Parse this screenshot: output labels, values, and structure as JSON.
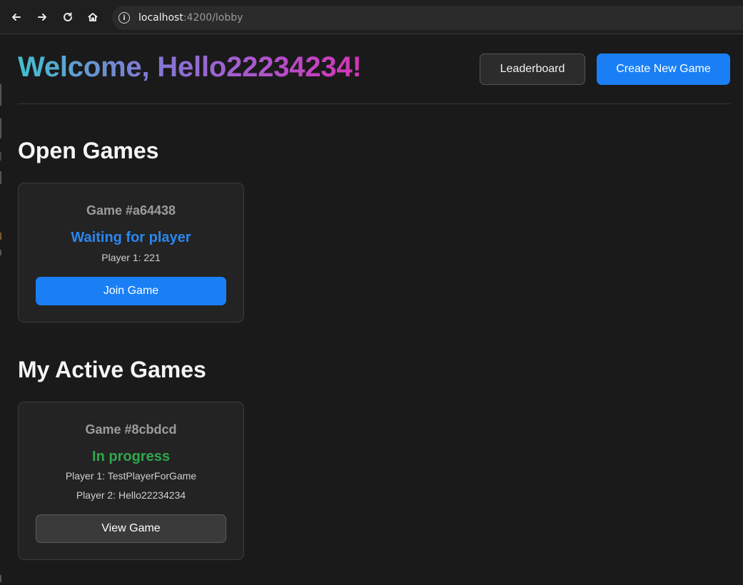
{
  "browser": {
    "url_host": "localhost",
    "url_path": ":4200/lobby"
  },
  "header": {
    "welcome": "Welcome, Hello22234234!",
    "leaderboard_label": "Leaderboard",
    "create_label": "Create New Game",
    "accent_color": "#1a7ff5",
    "gradient_colors": [
      "#44bfcf",
      "#7d7dd4",
      "#a55ccf",
      "#d533b7"
    ]
  },
  "open_games": {
    "title": "Open Games",
    "games": [
      {
        "title": "Game #a64438",
        "status": "Waiting for player",
        "status_color": "#2a87f0",
        "player1": "Player 1: 221",
        "button": "Join Game"
      }
    ]
  },
  "active_games": {
    "title": "My Active Games",
    "games": [
      {
        "title": "Game #8cbdcd",
        "status": "In progress",
        "status_color": "#2fa74c",
        "player1": "Player 1: TestPlayerForGame",
        "player2": "Player 2: Hello22234234",
        "button": "View Game"
      }
    ]
  }
}
